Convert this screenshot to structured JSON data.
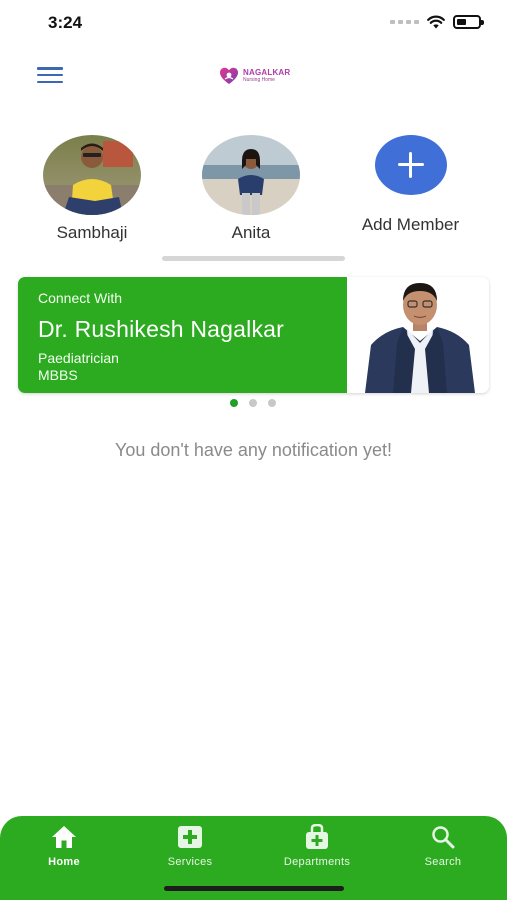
{
  "status_bar": {
    "time": "3:24"
  },
  "header": {
    "logo": {
      "name": "NAGALKAR",
      "sub": "Nursing Home"
    }
  },
  "members": [
    {
      "name": "Sambhaji"
    },
    {
      "name": "Anita"
    }
  ],
  "add_member": {
    "label": "Add Member"
  },
  "doctor_card": {
    "connect_label": "Connect With",
    "doctor_name": "Dr. Rushikesh Nagalkar",
    "specialty": "Paediatrician",
    "degree": "MBBS"
  },
  "carousel": {
    "pages": 3,
    "active_index": 0
  },
  "notifications": {
    "empty_message": "You don't have any notification yet!"
  },
  "bottom_nav": {
    "items": [
      {
        "label": "Home",
        "icon": "home-icon",
        "active": true
      },
      {
        "label": "Services",
        "icon": "medical-plus-icon",
        "active": false
      },
      {
        "label": "Departments",
        "icon": "medical-bag-icon",
        "active": false
      },
      {
        "label": "Search",
        "icon": "search-icon",
        "active": false
      }
    ]
  },
  "colors": {
    "primary_green": "#2cab20",
    "accent_blue": "#3f6fd7",
    "menu_blue": "#3b67b5",
    "brand_purple": "#b03aa8"
  }
}
